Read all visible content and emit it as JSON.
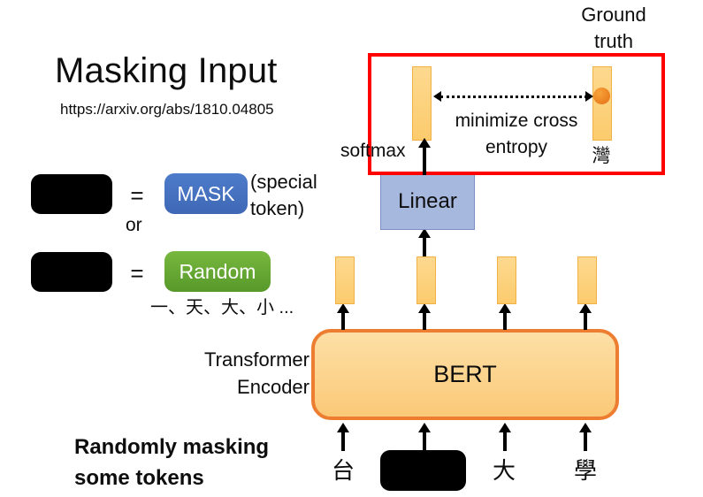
{
  "slide": {
    "title": "Masking Input",
    "url": "https://arxiv.org/abs/1810.04805"
  },
  "legend": {
    "equals_1": "=",
    "equals_2": "=",
    "or": "or",
    "mask_chip": "MASK",
    "mask_note": "(special token)",
    "random_chip": "Random",
    "random_examples": "一、天、大、小 ..."
  },
  "labels": {
    "transformer_encoder": "Transformer Encoder",
    "randomly_masking": "Randomly masking some tokens",
    "softmax": "softmax",
    "ground_truth": "Ground truth",
    "minimize_cross_entropy": "minimize cross entropy",
    "bert": "BERT",
    "linear": "Linear",
    "ground_truth_token": "灣"
  },
  "input_tokens": [
    {
      "text": "台",
      "masked": false
    },
    {
      "text": "",
      "masked": true
    },
    {
      "text": "大",
      "masked": false
    },
    {
      "text": "學",
      "masked": false
    }
  ],
  "colors": {
    "mask_chip_blue": "#4473c4",
    "random_chip_green": "#61a830",
    "bert_orange_fill": "#fcd186",
    "bert_orange_border": "#ed7d31",
    "linear_blue": "#a6b8dd",
    "vector_yellow": "#fcd57e",
    "vector_yellow_border": "#f0b247",
    "highlight_red": "#ff0000",
    "ground_truth_dot": "#ed7d31",
    "text_black": "#0d0d0d"
  }
}
